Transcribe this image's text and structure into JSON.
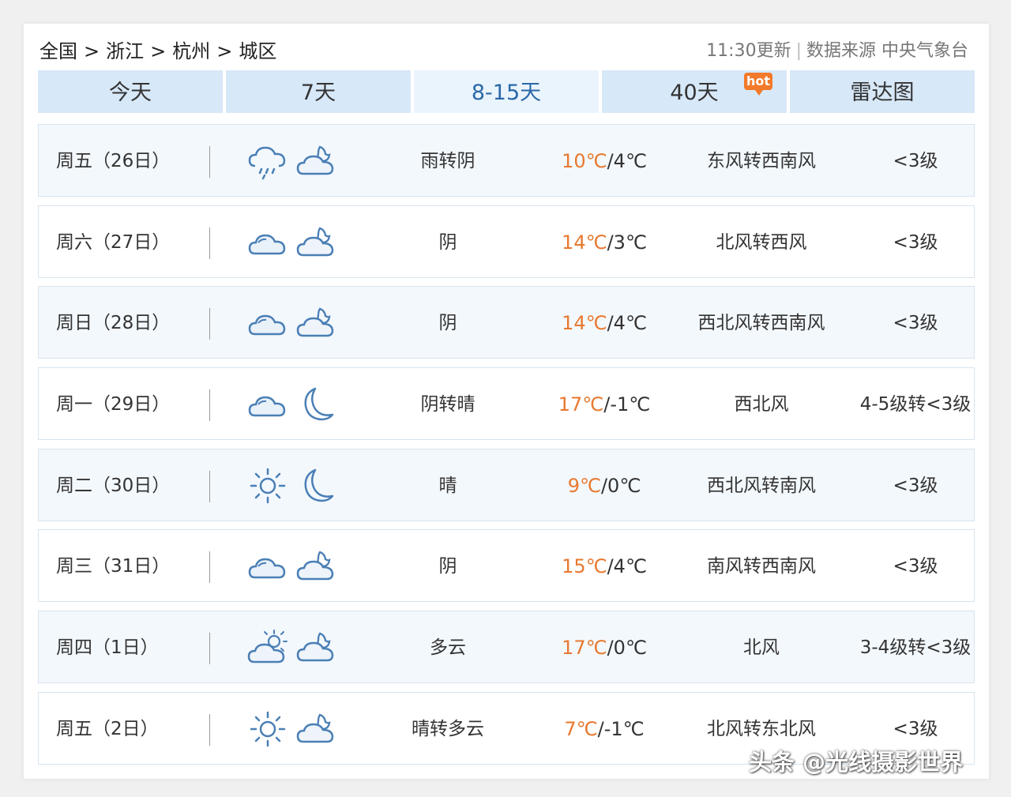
{
  "breadcrumb": {
    "items": [
      "全国",
      "浙江",
      "杭州",
      "城区"
    ],
    "separator": ">"
  },
  "meta": {
    "update_time": "11:30更新",
    "source": "数据来源 中央气象台"
  },
  "tabs": [
    {
      "label": "今天",
      "active": false
    },
    {
      "label": "7天",
      "active": false
    },
    {
      "label": "8-15天",
      "active": true
    },
    {
      "label": "40天",
      "active": false
    },
    {
      "label": "雷达图",
      "active": false
    }
  ],
  "hot_badge": "hot",
  "forecast": [
    {
      "day": "周五（26日）",
      "icon_day": "rain-cloud-icon",
      "icon_night": "cloud-moon-icon",
      "desc": "雨转阴",
      "hi": "10℃",
      "lo": "4℃",
      "wind": "东风转西南风",
      "level": "<3级"
    },
    {
      "day": "周六（27日）",
      "icon_day": "cloud-icon",
      "icon_night": "cloud-moon-icon",
      "desc": "阴",
      "hi": "14℃",
      "lo": "3℃",
      "wind": "北风转西风",
      "level": "<3级"
    },
    {
      "day": "周日（28日）",
      "icon_day": "cloud-icon",
      "icon_night": "cloud-moon-icon",
      "desc": "阴",
      "hi": "14℃",
      "lo": "4℃",
      "wind": "西北风转西南风",
      "level": "<3级"
    },
    {
      "day": "周一（29日）",
      "icon_day": "cloud-icon",
      "icon_night": "moon-icon",
      "desc": "阴转晴",
      "hi": "17℃",
      "lo": "-1℃",
      "wind": "西北风",
      "level": "4-5级转<3级"
    },
    {
      "day": "周二（30日）",
      "icon_day": "sun-icon",
      "icon_night": "moon-icon",
      "desc": "晴",
      "hi": "9℃",
      "lo": "0℃",
      "wind": "西北风转南风",
      "level": "<3级"
    },
    {
      "day": "周三（31日）",
      "icon_day": "cloud-icon",
      "icon_night": "cloud-moon-icon",
      "desc": "阴",
      "hi": "15℃",
      "lo": "4℃",
      "wind": "南风转西南风",
      "level": "<3级"
    },
    {
      "day": "周四（1日）",
      "icon_day": "cloud-sun-icon",
      "icon_night": "cloud-moon-icon",
      "desc": "多云",
      "hi": "17℃",
      "lo": "0℃",
      "wind": "北风",
      "level": "3-4级转<3级"
    },
    {
      "day": "周五（2日）",
      "icon_day": "sun-icon",
      "icon_night": "cloud-moon-icon",
      "desc": "晴转多云",
      "hi": "7℃",
      "lo": "-1℃",
      "wind": "北风转东北风",
      "level": "<3级"
    }
  ],
  "watermark": "头条 @光线摄影世界",
  "colors": {
    "tab_bg": "#d7e8f8",
    "tab_active_bg": "#eaf4fd",
    "tab_active_text": "#2a68a8",
    "high_temp": "#e8782e",
    "icon_stroke": "#4a7fb5",
    "hot_badge": "#f27a2a"
  }
}
